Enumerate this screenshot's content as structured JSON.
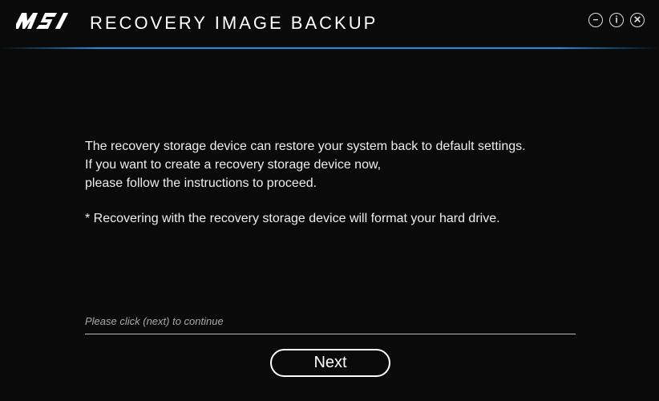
{
  "header": {
    "brand": "msi",
    "title": "RECOVERY IMAGE BACKUP"
  },
  "window_controls": {
    "minimize_glyph": "−",
    "info_glyph": "i",
    "close_glyph": "✕"
  },
  "body": {
    "paragraph1": "The recovery storage device can restore your system back to default settings.\nIf you want to create a recovery storage device now,\nplease follow the instructions to proceed.",
    "note": "* Recovering with the recovery storage device will format your hard drive."
  },
  "footer": {
    "hint": "Please click (next) to continue",
    "next_label": "Next"
  }
}
